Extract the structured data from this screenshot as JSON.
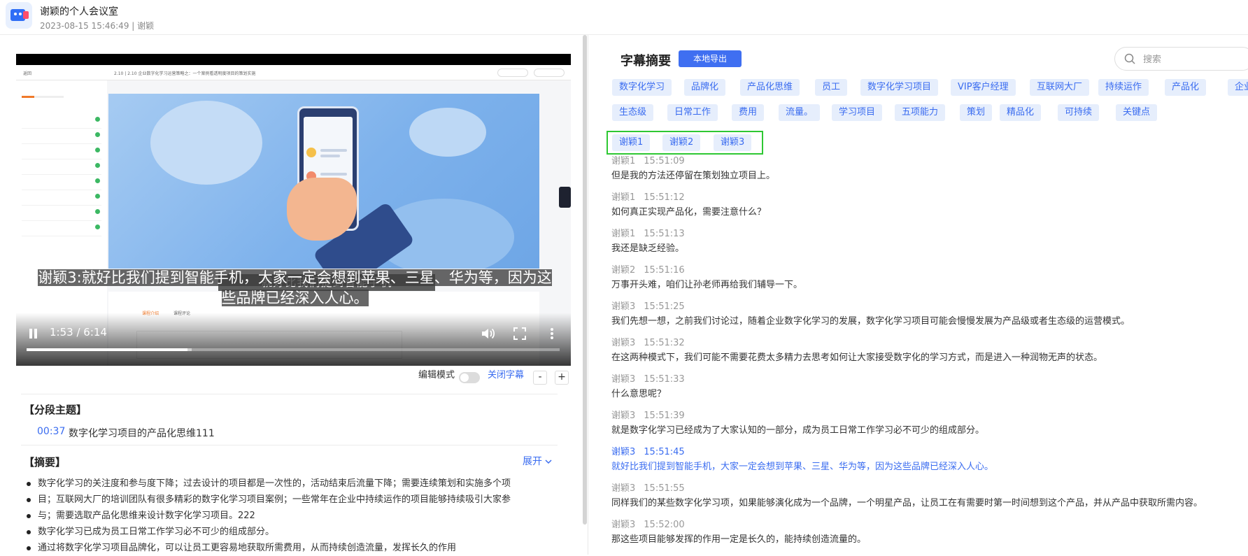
{
  "header": {
    "title": "谢颖的个人会议室",
    "meta": "2023-08-15 15:46:49 | 谢颖"
  },
  "video": {
    "embedded_subtitle": "就好比我们提到智能手机",
    "caption_line1": "谢颖3:就好比我们提到智能手机，大家一定会想到苹果、三星、华为等，因为这",
    "caption_line2": "些品牌已经深入人心。",
    "time": "1:53 / 6:14",
    "progress": 0.302,
    "buffered": 0.31,
    "lms_back": "返回",
    "lms_title": "2.10 | 2.10 企业数字化学习运营策略之：一个案例看透明度项目的策划实施",
    "lms_tab1": "课程介绍",
    "lms_tab2": "课程评论"
  },
  "subtitle_controls": {
    "edit_mode_label": "编辑模式",
    "close_subtitle": "关闭字幕",
    "minus": "-",
    "plus": "+"
  },
  "segments": {
    "heading": "【分段主题】",
    "items": [
      {
        "time": "00:37",
        "text": "数字化学习项目的产品化思维111"
      }
    ]
  },
  "summary": {
    "heading": "【摘要】",
    "expand": "展开",
    "bullets": [
      "数字化学习的关注度和参与度下降；过去设计的项目都是一次性的，活动结束后流量下降；需要连续策划和实施多个项",
      "目；互联网大厂的培训团队有很多精彩的数字化学习项目案例；一些常年在企业中持续运作的项目能够持续吸引大家参",
      "与；需要选取产品化思维来设计数字化学习项目。222",
      "数字化学习已成为员工日常工作学习必不可少的组成部分。",
      "通过将数字化学习项目品牌化，可以让员工更容易地获取所需费用，从而持续创造流量，发挥长久的作用"
    ]
  },
  "right": {
    "title": "字幕摘要",
    "export_button": "本地导出",
    "search_placeholder": "搜索",
    "tags_row1": [
      "数字化学习",
      "品牌化",
      "产品化思维",
      "员工",
      "数字化学习项目",
      "VIP客户经理",
      "互联网大厂",
      "持续运作",
      "产品化",
      "企业"
    ],
    "tags_row2": [
      "生态级",
      "日常工作",
      "费用",
      "流量。",
      "学习项目",
      "五项能力",
      "策划",
      "精品化",
      "可持续",
      "关键点"
    ],
    "speakers": [
      "谢颖1",
      "谢颖2",
      "谢颖3"
    ],
    "entries": [
      {
        "speaker": "谢颖1",
        "time": "15:51:09",
        "text": "但是我的方法还停留在策划独立项目上。"
      },
      {
        "speaker": "谢颖1",
        "time": "15:51:12",
        "text": "如何真正实现产品化，需要注意什么？"
      },
      {
        "speaker": "谢颖1",
        "time": "15:51:13",
        "text": "我还是缺乏经验。"
      },
      {
        "speaker": "谢颖2",
        "time": "15:51:16",
        "text": "万事开头难，咱们让孙老师再给我们辅导一下。"
      },
      {
        "speaker": "谢颖3",
        "time": "15:51:25",
        "text": "我们先想一想，之前我们讨论过，随着企业数字化学习的发展，数字化学习项目可能会慢慢发展为产品级或者生态级的运营模式。"
      },
      {
        "speaker": "谢颖3",
        "time": "15:51:32",
        "text": "在这两种模式下，我们可能不需要花费太多精力去思考如何让大家接受数字化的学习方式，而是进入一种润物无声的状态。"
      },
      {
        "speaker": "谢颖3",
        "time": "15:51:33",
        "text": "什么意思呢？"
      },
      {
        "speaker": "谢颖3",
        "time": "15:51:39",
        "text": "就是数字化学习已经成为了大家认知的一部分，成为员工日常工作学习必不可少的组成部分。"
      },
      {
        "speaker": "谢颖3",
        "time": "15:51:45",
        "text": "就好比我们提到智能手机，大家一定会想到苹果、三星、华为等，因为这些品牌已经深入人心。",
        "active": true
      },
      {
        "speaker": "谢颖3",
        "time": "15:51:55",
        "text": "同样我们的某些数字化学习项，如果能够演化成为一个品牌，一个明星产品，让员工在有需要时第一时间想到这个产品，并从产品中获取所需内容。"
      },
      {
        "speaker": "谢颖3",
        "time": "15:52:00",
        "text": "那这些项目能够发挥的作用一定是长久的，能持续创造流量的。"
      }
    ]
  },
  "colors": {
    "accent": "#3a6cf0",
    "tag_bg": "#e6eefc",
    "speaker_highlight": "#2ec833",
    "export_bg": "#3f6ff1"
  }
}
